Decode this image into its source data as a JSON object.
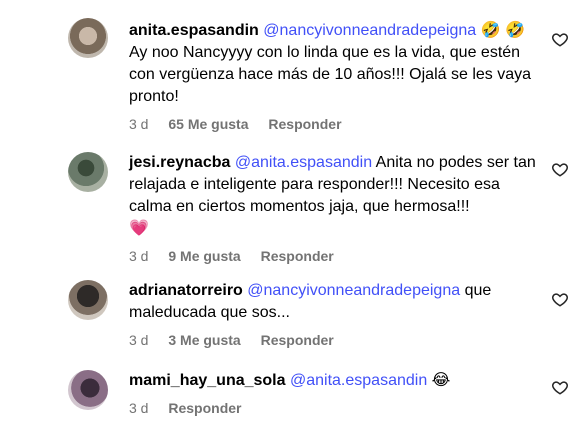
{
  "comments": [
    {
      "username": "anita.espasandin",
      "mention": "@nancyivonneandradepeigna",
      "text": "Ay noo Nancyyyy con lo linda que es la vida, que estén con vergüenza hace más de 10 años!!! Ojalá se les vaya pronto!",
      "emoji_after_mention": "🤣 🤣",
      "age": "3 d",
      "likes": "65 Me gusta",
      "reply_label": "Responder"
    },
    {
      "username": "jesi.reynacba",
      "mention": "@anita.espasandin",
      "text": "Anita no podes ser tan relajada e inteligente para responder!!! Necesito esa calma en ciertos momentos jaja, que hermosa!!!",
      "emoji_end": "💗",
      "age": "3 d",
      "likes": "9 Me gusta",
      "reply_label": "Responder"
    },
    {
      "username": "adrianatorreiro",
      "mention": "@nancyivonneandradepeigna",
      "text": "que maleducada que sos...",
      "age": "3 d",
      "likes": "3 Me gusta",
      "reply_label": "Responder"
    },
    {
      "username": "mami_hay_una_sola",
      "mention": "@anita.espasandin",
      "emoji_end": "😂",
      "age": "3 d",
      "reply_label": "Responder"
    }
  ],
  "icons": {
    "like": "heart-outline-icon"
  },
  "colors": {
    "mention": "#4150f7",
    "meta": "#737373"
  }
}
